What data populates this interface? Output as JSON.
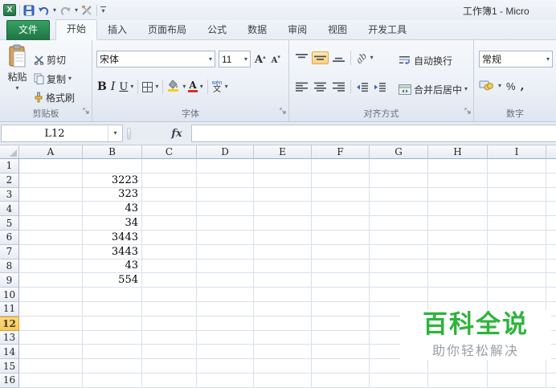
{
  "window": {
    "title": "工作簿1 - Micro"
  },
  "icons": {
    "qat": [
      "excel-logo",
      "save-icon",
      "undo-icon",
      "redo-icon",
      "tools-icon",
      "qat-more-icon"
    ],
    "misc": [
      "dropdown-arrow",
      "dialog-launcher-icon",
      "fx-icon",
      "select-all-corner"
    ]
  },
  "tabs": [
    {
      "id": "file",
      "label": "文件",
      "type": "file"
    },
    {
      "id": "home",
      "label": "开始",
      "active": true
    },
    {
      "id": "insert",
      "label": "插入"
    },
    {
      "id": "page-layout",
      "label": "页面布局"
    },
    {
      "id": "formulas",
      "label": "公式"
    },
    {
      "id": "data",
      "label": "数据"
    },
    {
      "id": "review",
      "label": "审阅"
    },
    {
      "id": "view",
      "label": "视图"
    },
    {
      "id": "developer",
      "label": "开发工具"
    }
  ],
  "ribbon": {
    "clipboard": {
      "group_label": "剪贴板",
      "paste": "粘贴",
      "cut": "剪切",
      "copy": "复制",
      "format_painter": "格式刷"
    },
    "font": {
      "group_label": "字体",
      "font_name": "宋体",
      "font_size": "11"
    },
    "alignment": {
      "group_label": "对齐方式",
      "wrap_text": "自动换行",
      "merge_center": "合并后居中"
    },
    "number": {
      "group_label": "数字",
      "number_format": "常规"
    }
  },
  "formula_bar": {
    "name_box": "L12",
    "fx": "fx",
    "formula": ""
  },
  "sheet": {
    "columns": [
      "A",
      "B",
      "C",
      "D",
      "E",
      "F",
      "G",
      "H",
      "I"
    ],
    "rows": [
      "1",
      "2",
      "3",
      "4",
      "5",
      "6",
      "7",
      "8",
      "9",
      "10",
      "11",
      "12",
      "13",
      "14",
      "15",
      "16"
    ],
    "selected_cell": "L12",
    "selected_row": "12",
    "cells": {
      "B2": "3223",
      "B3": "323",
      "B4": "43",
      "B5": "34",
      "B6": "3443",
      "B7": "3443",
      "B8": "43",
      "B9": "554"
    }
  },
  "watermark": {
    "title": "百科全说",
    "subtitle": "助你轻松解决",
    "title_color": "#2db43c",
    "subtitle_color": "#9aa0a6"
  },
  "colors": {
    "file_tab_green": "#1e7243",
    "selected_row_header": "#f8d265",
    "grid_line": "#d9e0ea",
    "highlight_amber": "#f9d27e"
  }
}
